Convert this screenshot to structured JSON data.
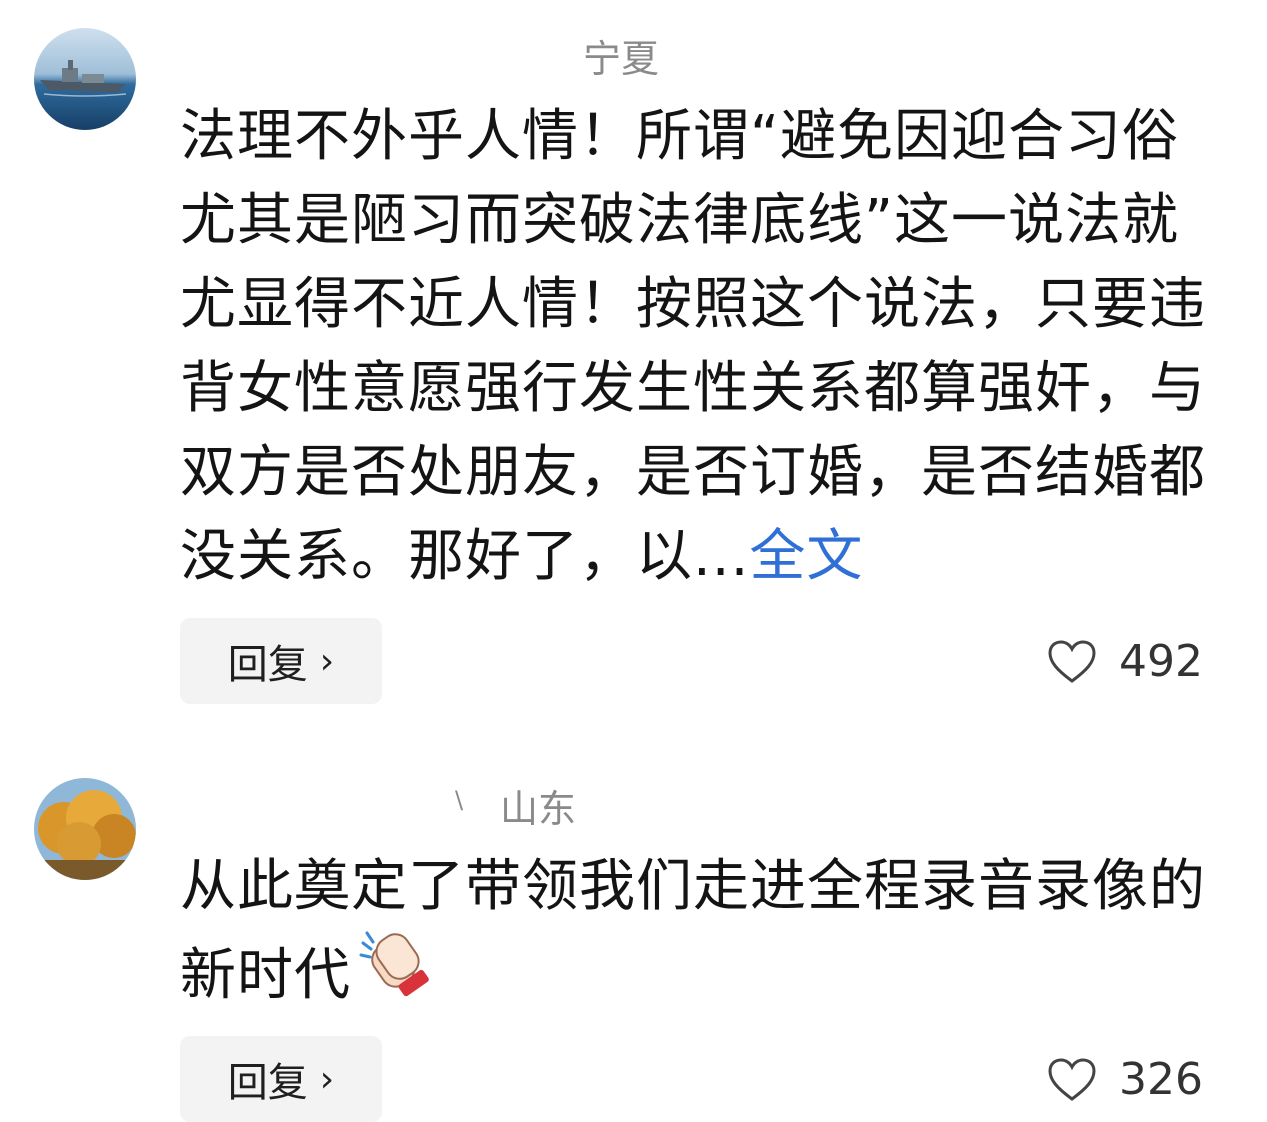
{
  "comments": [
    {
      "location": "宁夏",
      "text_before_link": "法理不外乎人情！所谓“避免因迎合习俗尤其是陋习而突破法律底线”这一说法就尤显得不近人情！按照这个说法，只要违背女性意愿强行发生性关系都算强奸，与双方是否处朋友，是否订婚，是否结婚都没关系。那好了，以...",
      "expand_label": "全文",
      "reply_label": "回复",
      "reply_chevron": "›",
      "like_count": "492",
      "avatar_icon": "warship-avatar-icon",
      "like_icon": "heart-outline-icon"
    },
    {
      "name_fragment": "\\",
      "location": "山东",
      "text": "从此奠定了带领我们走进全程录音录像的新时代",
      "emoji_icon": "clapping-hands-icon",
      "reply_label": "回复",
      "reply_chevron": "›",
      "like_count": "326",
      "avatar_icon": "autumn-tree-avatar-icon",
      "like_icon": "heart-outline-icon"
    }
  ],
  "colors": {
    "link": "#2f6fd6",
    "meta": "#8a8a8a",
    "reply_bg": "#f3f3f3"
  }
}
